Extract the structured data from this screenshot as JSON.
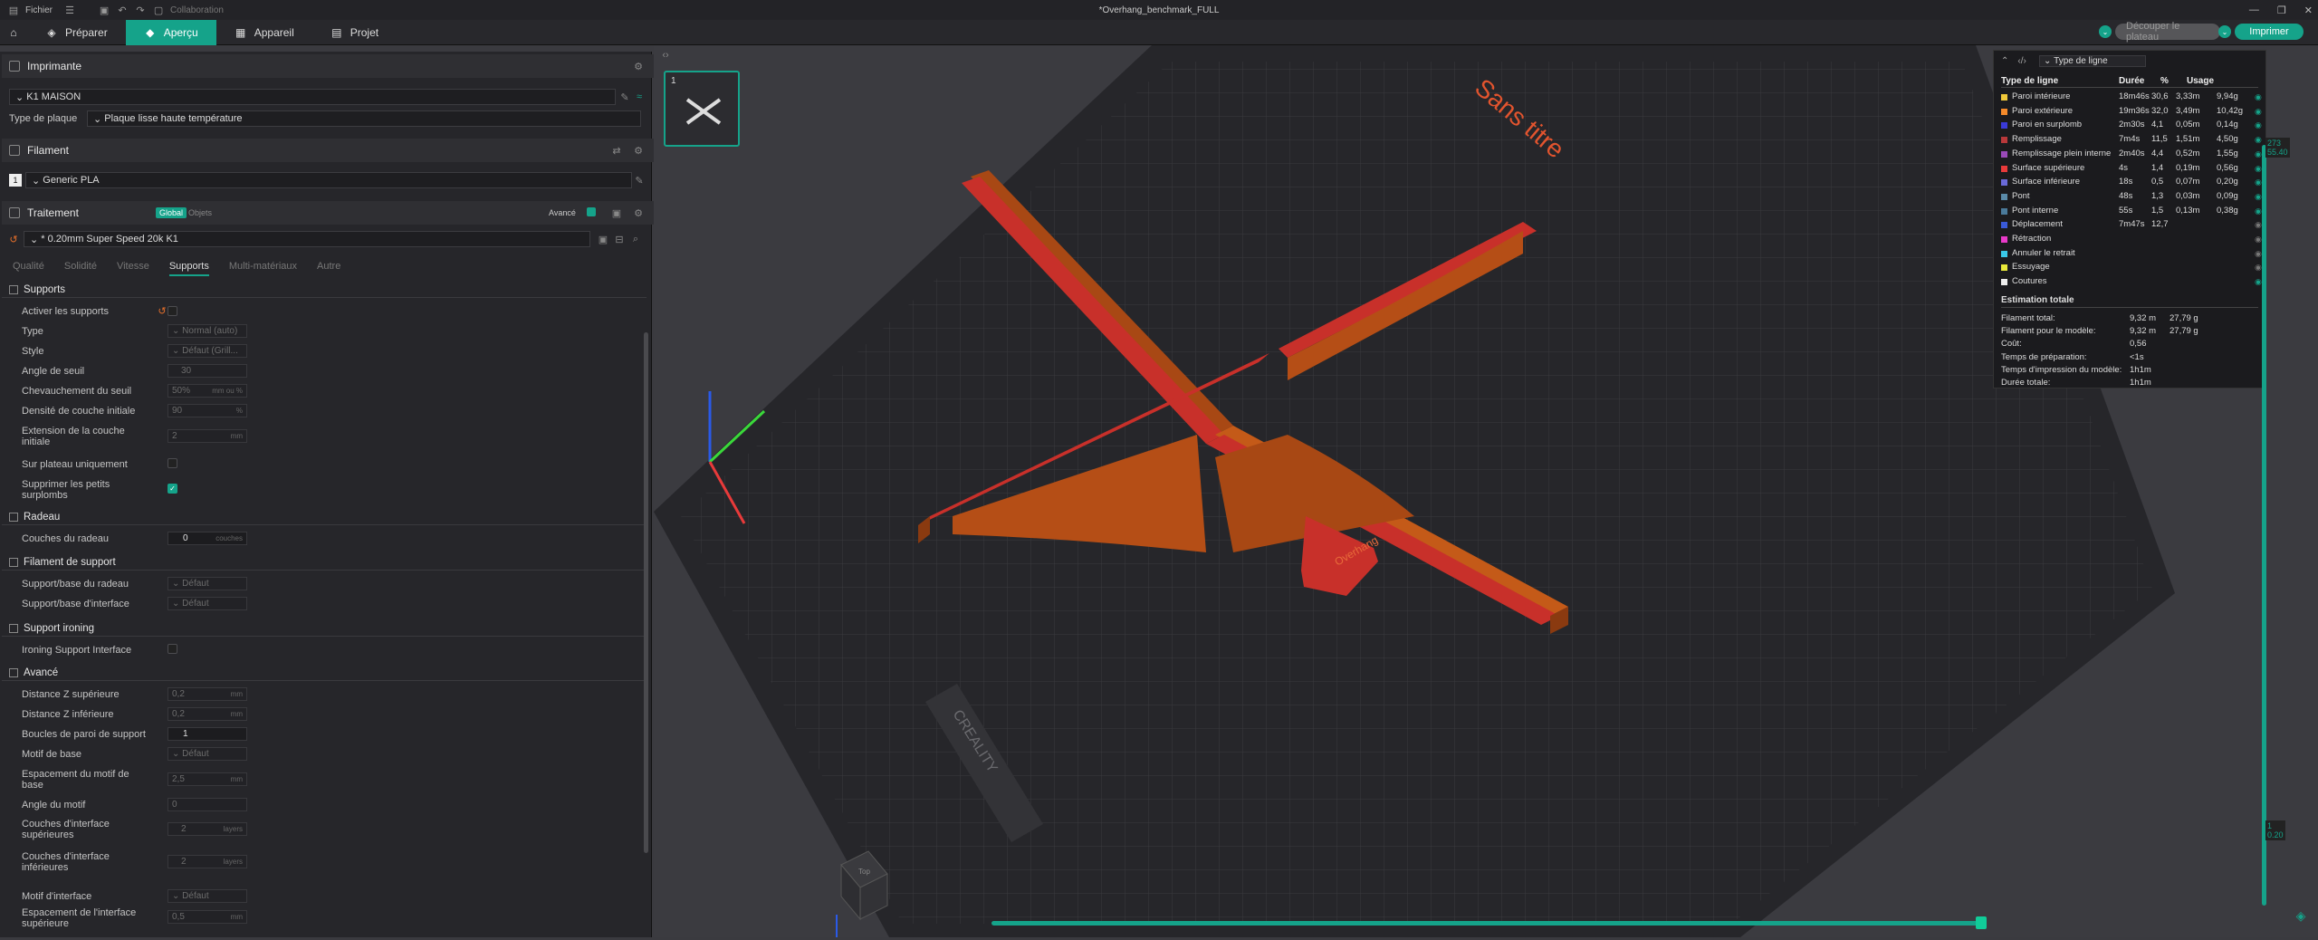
{
  "titlebar": {
    "menu_file": "Fichier",
    "collab": "Collaboration",
    "title": "*Overhang_benchmark_FULL"
  },
  "tabs": [
    {
      "label": "Préparer"
    },
    {
      "label": "Aperçu"
    },
    {
      "label": "Appareil"
    },
    {
      "label": "Projet"
    }
  ],
  "actions": {
    "slice_label": "Découper le plateau",
    "print_label": "Imprimer"
  },
  "printer": {
    "header": "Imprimante",
    "name": "K1 MAISON",
    "plate_label": "Type de plaque",
    "plate_value": "Plaque lisse haute température"
  },
  "filament": {
    "header": "Filament",
    "slot": "1",
    "value": "Generic PLA"
  },
  "process": {
    "header": "Traitement",
    "toggle_global": "Global",
    "toggle_objects": "Objets",
    "advanced": "Avancé",
    "profile": "* 0.20mm Super Speed 20k K1",
    "subtabs": [
      "Qualité",
      "Solidité",
      "Vitesse",
      "Supports",
      "Multi-matériaux",
      "Autre"
    ]
  },
  "settings": {
    "g_supports": "Supports",
    "enable": "Activer les supports",
    "type_l": "Type",
    "type_v": "Normal (auto)",
    "style_l": "Style",
    "style_v": "Défaut (Grill...",
    "angle_l": "Angle de seuil",
    "angle_v": "30",
    "overlap_l": "Chevauchement du seuil",
    "overlap_v": "50%",
    "overlap_u": "mm ou %",
    "density_l": "Densité de couche initiale",
    "density_v": "90",
    "density_u": "%",
    "ext_l1": "Extension de la couche",
    "ext_l2": "initiale",
    "ext_v": "2",
    "ext_u": "mm",
    "plate_only": "Sur plateau uniquement",
    "remove_l1": "Supprimer les petits",
    "remove_l2": "surplombs",
    "g_raft": "Radeau",
    "raft_layers_l": "Couches du radeau",
    "raft_layers_v": "0",
    "raft_layers_u": "couches",
    "g_fil": "Filament de support",
    "raft_base_l": "Support/base du radeau",
    "raft_base_v": "Défaut",
    "iface_l": "Support/base d'interface",
    "iface_v": "Défaut",
    "g_iron": "Support ironing",
    "iron_l": "Ironing Support Interface",
    "g_adv": "Avancé",
    "ztop_l": "Distance Z supérieure",
    "ztop_v": "0,2",
    "ztop_u": "mm",
    "zbot_l": "Distance Z inférieure",
    "zbot_v": "0,2",
    "zbot_u": "mm",
    "loops_l": "Boucles de paroi de support",
    "loops_v": "1",
    "base_pat_l": "Motif de base",
    "base_pat_v": "Défaut",
    "base_sp_l1": "Espacement du motif de",
    "base_sp_l2": "base",
    "base_sp_v": "2,5",
    "base_sp_u": "mm",
    "pat_ang_l": "Angle du motif",
    "pat_ang_v": "0",
    "top_if_l1": "Couches d'interface",
    "top_if_l2": "supérieures",
    "top_if_v": "2",
    "top_if_u": "layers",
    "bot_if_l1": "Couches d'interface",
    "bot_if_l2": "inférieures",
    "bot_if_v": "2",
    "bot_if_u": "layers",
    "if_pat_l": "Motif d'interface",
    "if_pat_v": "Défaut",
    "if_sp_l1": "Espacement de l'interface",
    "if_sp_l2": "supérieure",
    "if_sp_v": "0,5",
    "if_sp_u": "mm"
  },
  "viewport": {
    "plate_name": "Sans titre",
    "brand": "CREALITY",
    "model_text": "Overhang",
    "thumb_index": "1",
    "cube_label": "Top"
  },
  "legend": {
    "dropdown": "Type de ligne",
    "col_type": "Type de ligne",
    "col_time": "Durée",
    "col_pct": "%",
    "col_usage": "Usage",
    "rows": [
      {
        "name": "Paroi intérieure",
        "time": "18m46s",
        "pct": "30,6",
        "len": "3,33m",
        "wt": "9,94g",
        "color": "#f0c93a",
        "vis": true
      },
      {
        "name": "Paroi extérieure",
        "time": "19m36s",
        "pct": "32,0",
        "len": "3,49m",
        "wt": "10,42g",
        "color": "#f58a2a",
        "vis": true
      },
      {
        "name": "Paroi en surplomb",
        "time": "2m30s",
        "pct": "4,1",
        "len": "0,05m",
        "wt": "0,14g",
        "color": "#3a3ad8",
        "vis": true
      },
      {
        "name": "Remplissage",
        "time": "7m4s",
        "pct": "11,5",
        "len": "1,51m",
        "wt": "4,50g",
        "color": "#b8383a",
        "vis": true
      },
      {
        "name": "Remplissage plein interne",
        "time": "2m40s",
        "pct": "4,4",
        "len": "0,52m",
        "wt": "1,55g",
        "color": "#9a4ab8",
        "vis": true
      },
      {
        "name": "Surface supérieure",
        "time": "4s",
        "pct": "1,4",
        "len": "0,19m",
        "wt": "0,56g",
        "color": "#e83a3a",
        "vis": true
      },
      {
        "name": "Surface inférieure",
        "time": "18s",
        "pct": "0,5",
        "len": "0,07m",
        "wt": "0,20g",
        "color": "#6a6ad8",
        "vis": true
      },
      {
        "name": "Pont",
        "time": "48s",
        "pct": "1,3",
        "len": "0,03m",
        "wt": "0,09g",
        "color": "#5a8aa8",
        "vis": true
      },
      {
        "name": "Pont interne",
        "time": "55s",
        "pct": "1,5",
        "len": "0,13m",
        "wt": "0,38g",
        "color": "#4a7a9a",
        "vis": true
      },
      {
        "name": "Déplacement",
        "time": "7m47s",
        "pct": "12,7",
        "len": "",
        "wt": "",
        "color": "#3a5ad8",
        "vis": false
      },
      {
        "name": "Rétraction",
        "time": "",
        "pct": "",
        "len": "",
        "wt": "",
        "color": "#e83ac8",
        "vis": false
      },
      {
        "name": "Annuler le retrait",
        "time": "",
        "pct": "",
        "len": "",
        "wt": "",
        "color": "#3ac8e8",
        "vis": false
      },
      {
        "name": "Essuyage",
        "time": "",
        "pct": "",
        "len": "",
        "wt": "",
        "color": "#e8e83a",
        "vis": false
      },
      {
        "name": "Coutures",
        "time": "",
        "pct": "",
        "len": "",
        "wt": "",
        "color": "#eeeeee",
        "vis": true
      }
    ],
    "totals_title": "Estimation totale",
    "totals": [
      {
        "label": "Filament total:",
        "a": "9,32 m",
        "b": "27,79 g"
      },
      {
        "label": "Filament pour le modèle:",
        "a": "9,32 m",
        "b": "27,79 g"
      },
      {
        "label": "Coût:",
        "a": "0,56",
        "b": ""
      },
      {
        "label": "Temps de préparation:",
        "a": "<1s",
        "b": ""
      },
      {
        "label": "Temps d'impression du modèle:",
        "a": "1h1m",
        "b": ""
      },
      {
        "label": "Durée totale:",
        "a": "1h1m",
        "b": ""
      }
    ]
  },
  "sliders": {
    "top_layer": "273",
    "top_height": "55.40",
    "bottom_layer": "1",
    "bottom_height": "0.20"
  },
  "colors": {
    "accent": "#15a38a",
    "model": "#c45a18",
    "model_top": "#c8302a"
  }
}
